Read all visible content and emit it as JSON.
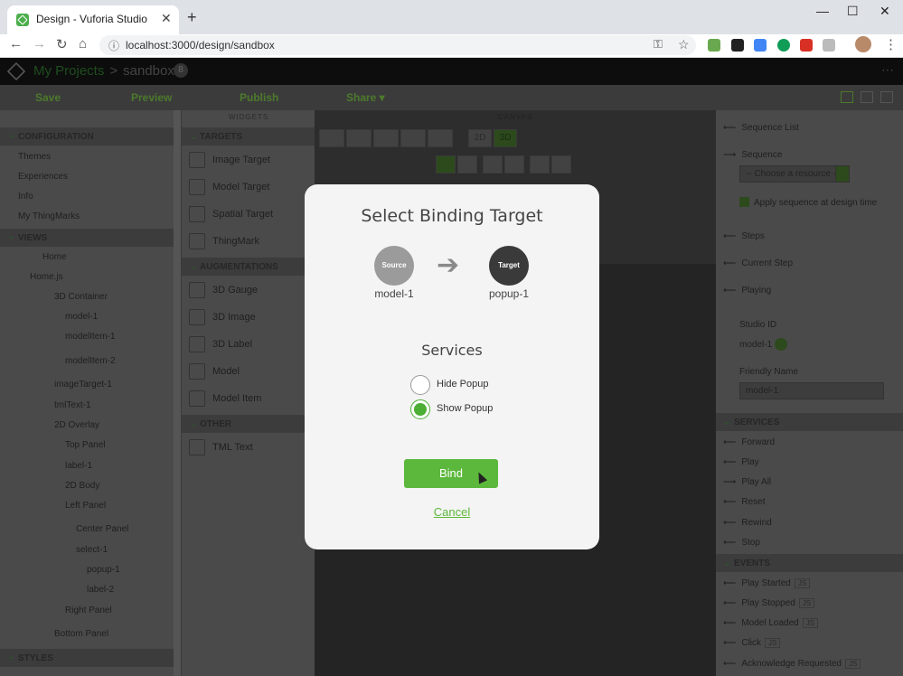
{
  "browser": {
    "tab_title": "Design - Vuforia Studio",
    "url": "localhost:3000/design/sandbox"
  },
  "app": {
    "breadcrumb_root": "My Projects",
    "breadcrumb_sep": ">",
    "project": "sandbox",
    "badge": "8",
    "toolbar": {
      "save": "Save",
      "preview": "Preview",
      "publish": "Publish",
      "share": "Share ▾"
    }
  },
  "left_panel": {
    "configuration_label": "CONFIGURATION",
    "config_items": [
      "Themes",
      "Experiences",
      "Info",
      "My ThingMarks"
    ],
    "views_label": "VIEWS",
    "tree": [
      "Home",
      "Home.js",
      "3D Container",
      "model-1",
      "modelItem-1",
      "modelItem-2",
      "imageTarget-1",
      "tmlText-1",
      "2D Overlay",
      "Top Panel",
      "label-1",
      "2D Body",
      "Left Panel",
      "Center Panel",
      "select-1",
      "popup-1",
      "label-2",
      "Right Panel",
      "Bottom Panel"
    ],
    "styles_label": "STYLES"
  },
  "widgets": {
    "title": "WIDGETS",
    "targets_label": "TARGETS",
    "targets": [
      "Image Target",
      "Model Target",
      "Spatial Target",
      "ThingMark"
    ],
    "augmentations_label": "AUGMENTATIONS",
    "augmentations": [
      "3D Gauge",
      "3D Image",
      "3D Label",
      "Model",
      "Model Item"
    ],
    "other_label": "OTHER",
    "other": [
      "TML Text"
    ]
  },
  "canvas": {
    "title": "CANVAS",
    "mode_2d": "2D",
    "mode_3d": "3D"
  },
  "right_panel": {
    "sequence_list": "Sequence List",
    "sequence": "Sequence",
    "choose_resource": "-- Choose a resource --",
    "apply_sequence": "Apply sequence at design time",
    "steps": "Steps",
    "current_step": "Current Step",
    "playing": "Playing",
    "studio_id_label": "Studio ID",
    "studio_id_value": "model-1",
    "friendly_name_label": "Friendly Name",
    "friendly_name_value": "model-1",
    "services_label": "SERVICES",
    "services": [
      "Forward",
      "Play",
      "Play All",
      "Reset",
      "Rewind",
      "Stop"
    ],
    "events_label": "EVENTS",
    "events": [
      "Play Started",
      "Play Stopped",
      "Model Loaded",
      "Click",
      "Acknowledge Requested"
    ]
  },
  "modal": {
    "title": "Select Binding Target",
    "source_circle": "Source",
    "target_circle": "Target",
    "source_name": "model-1",
    "target_name": "popup-1",
    "services_heading": "Services",
    "options": [
      "Hide Popup",
      "Show Popup"
    ],
    "selected_option": "Show Popup",
    "bind_label": "Bind",
    "cancel_label": "Cancel"
  }
}
